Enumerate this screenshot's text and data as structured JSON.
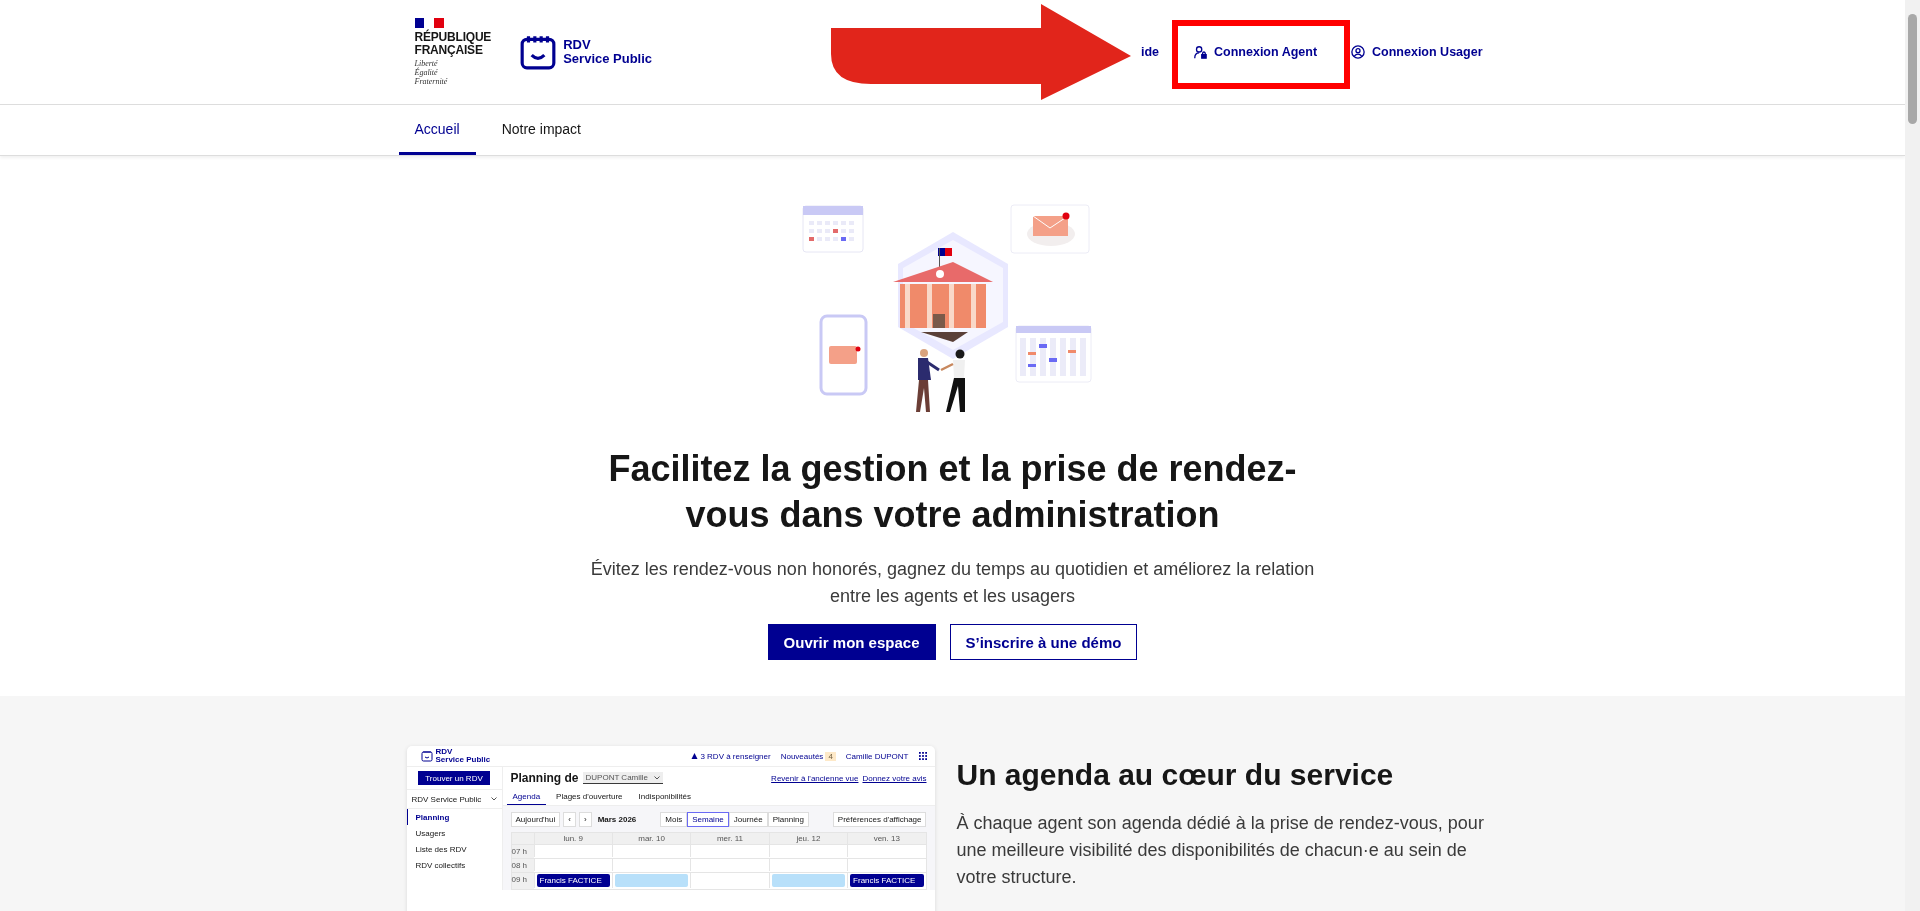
{
  "header": {
    "gov_logo": {
      "lines": [
        "RÉPUBLIQUE",
        "FRANÇAISE"
      ],
      "motto": [
        "Liberté",
        "Égalité",
        "Fraternité"
      ]
    },
    "service_name": [
      "RDV",
      "Service Public"
    ],
    "links": [
      {
        "label": "ide",
        "kind": "plain"
      },
      {
        "label": "Connexion Agent",
        "kind": "agent"
      },
      {
        "label": "Connexion Usager",
        "kind": "user"
      }
    ]
  },
  "nav": [
    {
      "label": "Accueil",
      "selected": true
    },
    {
      "label": "Notre impact",
      "selected": false
    }
  ],
  "hero": {
    "title": "Facilitez la gestion et la prise de rendez-vous dans votre administration",
    "subtitle": "Évitez les rendez-vous non honorés, gagnez du temps au quotidien et améliorez la relation entre les agents et les usagers",
    "buttons": [
      {
        "label": "Ouvrir mon espace",
        "kind": "primary"
      },
      {
        "label": "S’inscrire à une démo",
        "kind": "secondary"
      }
    ]
  },
  "feature": {
    "title": "Un agenda au cœur du service",
    "text": "À chaque agent son agenda dédié à la prise de rendez-vous, pour une meilleure visibilité des disponibilités de chacun·e au sein de votre structure.",
    "screenshot": {
      "logo": [
        "RDV",
        "Service Public"
      ],
      "alert": "3 RDV à renseigner",
      "news": {
        "label": "Nouveautés",
        "count": "4"
      },
      "user": "Camille DUPONT",
      "find_button": "Trouver un RDV",
      "org": "RDV Service Public",
      "menu": [
        {
          "label": "Planning",
          "selected": true
        },
        {
          "label": "Usagers",
          "selected": false
        },
        {
          "label": "Liste des RDV",
          "selected": false
        },
        {
          "label": "RDV collectifs",
          "selected": false
        }
      ],
      "page_title": "Planning de",
      "agent_select": "DUPONT Camille",
      "links": [
        "Revenir à l'ancienne vue",
        "Donnez votre avis"
      ],
      "tabs": [
        {
          "label": "Agenda",
          "selected": true
        },
        {
          "label": "Plages d'ouverture",
          "selected": false
        },
        {
          "label": "Indisponibilités",
          "selected": false
        }
      ],
      "today": "Aujourd'hui",
      "prev": "‹",
      "next": "›",
      "month": "Mars 2026",
      "views": [
        {
          "label": "Mois",
          "selected": false
        },
        {
          "label": "Semaine",
          "selected": true
        },
        {
          "label": "Journée",
          "selected": false
        },
        {
          "label": "Planning",
          "selected": false
        }
      ],
      "prefs": "Préférences d'affichage",
      "hours": [
        "07 h",
        "08 h",
        "09 h"
      ],
      "days": [
        {
          "label": "lun. 9",
          "event": {
            "kind": "dark",
            "label": "Francis FACTICE"
          }
        },
        {
          "label": "mar. 10",
          "event": {
            "kind": "light"
          }
        },
        {
          "label": "mer. 11"
        },
        {
          "label": "jeu. 12",
          "event": {
            "kind": "light"
          }
        },
        {
          "label": "ven. 13",
          "event": {
            "kind": "dark",
            "label": "Francis FACTICE"
          }
        }
      ]
    }
  },
  "annotations": {
    "arrow": true,
    "highlight_box": true
  }
}
